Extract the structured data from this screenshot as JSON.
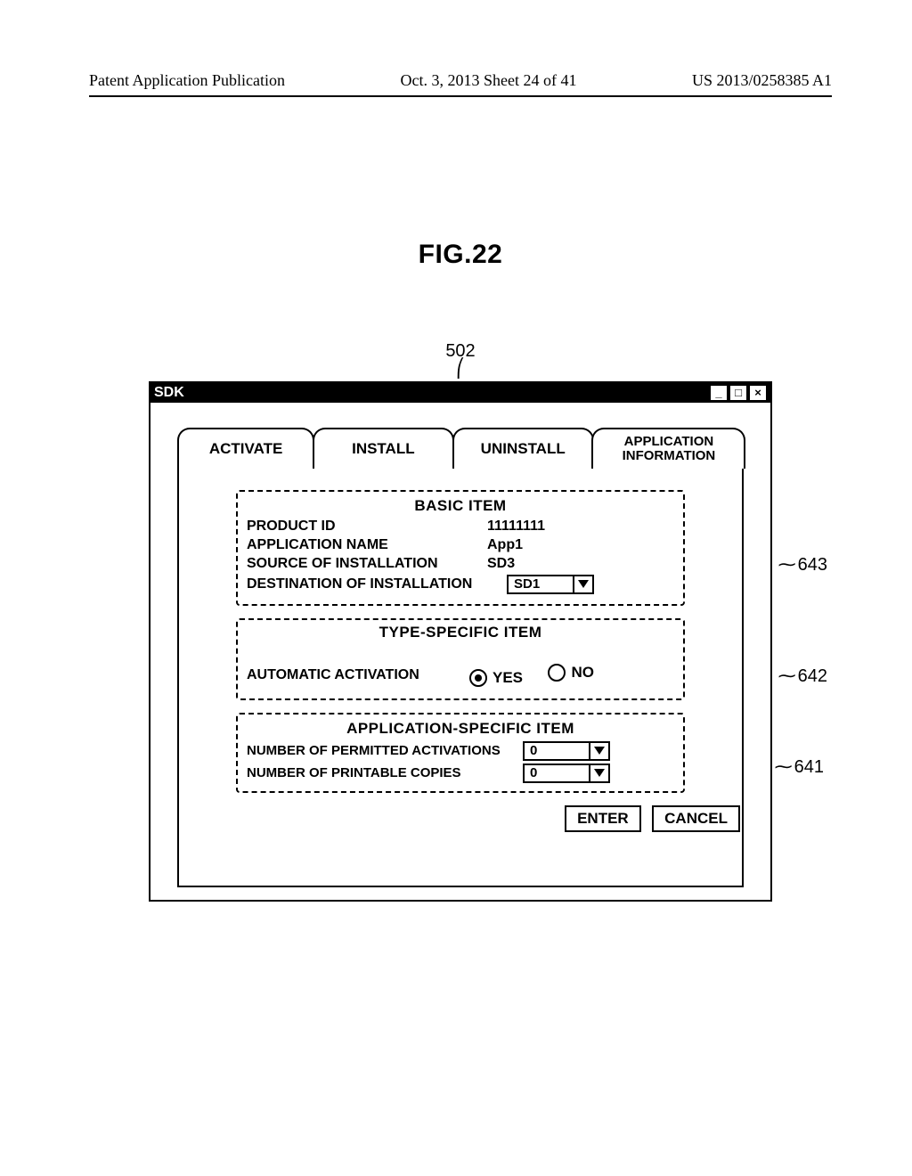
{
  "header": {
    "left": "Patent Application Publication",
    "center": "Oct. 3, 2013  Sheet 24 of 41",
    "right": "US 2013/0258385 A1"
  },
  "figure": {
    "caption": "FIG.22",
    "callout_top": "502"
  },
  "window": {
    "title": "SDK",
    "tabs": {
      "activate": "ACTIVATE",
      "install": "INSTALL",
      "uninstall": "UNINSTALL",
      "appinfo": "APPLICATION\nINFORMATION"
    },
    "basic": {
      "title": "BASIC ITEM",
      "product_id_label": "PRODUCT ID",
      "product_id_value": "11111111",
      "app_name_label": "APPLICATION NAME",
      "app_name_value": "App1",
      "src_label": "SOURCE OF INSTALLATION",
      "src_value": "SD3",
      "dest_label": "DESTINATION OF INSTALLATION",
      "dest_value": "SD1"
    },
    "type_specific": {
      "title": "TYPE-SPECIFIC ITEM",
      "auto_activation_label": "AUTOMATIC ACTIVATION",
      "yes": "YES",
      "no": "NO"
    },
    "app_specific": {
      "title": "APPLICATION-SPECIFIC ITEM",
      "activations_label": "NUMBER OF PERMITTED ACTIVATIONS",
      "activations_value": "0",
      "copies_label": "NUMBER OF PRINTABLE COPIES",
      "copies_value": "0"
    },
    "buttons": {
      "enter": "ENTER",
      "cancel": "CANCEL"
    }
  },
  "annotations": {
    "a643": "643",
    "a642": "642",
    "a641": "641"
  }
}
